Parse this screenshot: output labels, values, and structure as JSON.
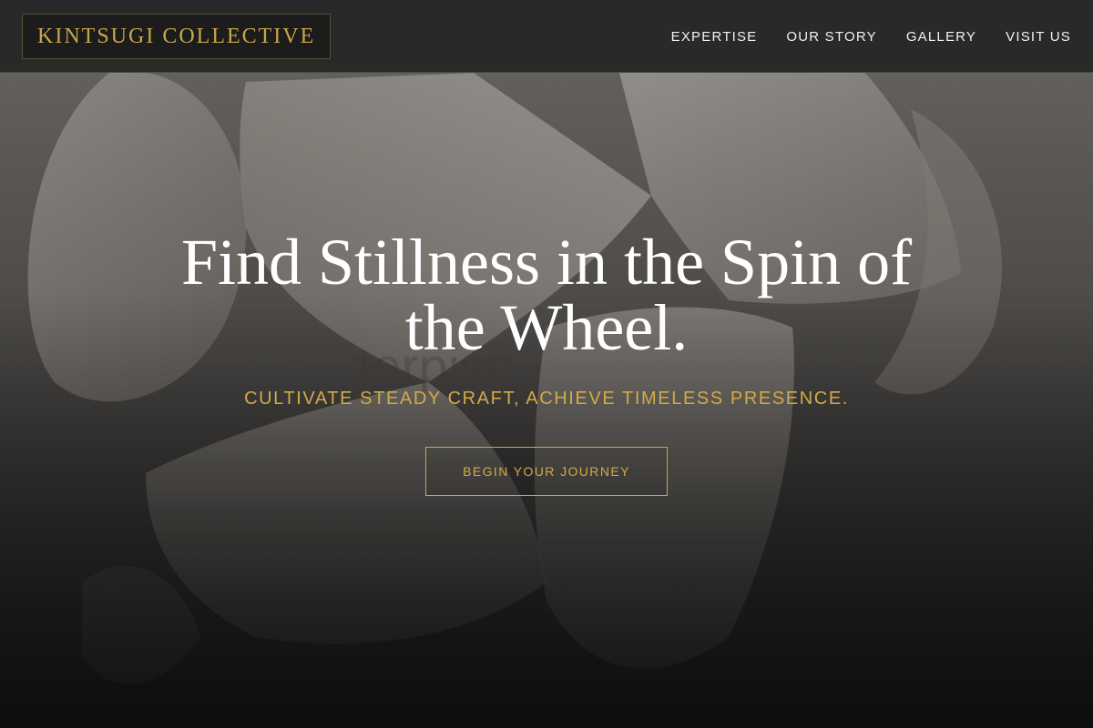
{
  "header": {
    "logo_text": "KINTSUGI COLLECTIVE",
    "nav": [
      {
        "label": "EXPERTISE"
      },
      {
        "label": "OUR STORY"
      },
      {
        "label": "GALLERY"
      },
      {
        "label": "VISIT US"
      }
    ]
  },
  "hero": {
    "title": "Find Stillness in the Spin of the Wheel.",
    "ghost_text": "torpise",
    "subtitle": "CULTIVATE STEADY CRAFT, ACHIEVE TIMELESS PRESENCE.",
    "cta_label": "BEGIN YOUR JOURNEY"
  },
  "colors": {
    "accent_gold": "#c9a64b",
    "header_bg": "#262626",
    "text_light": "#f2f2f2"
  }
}
